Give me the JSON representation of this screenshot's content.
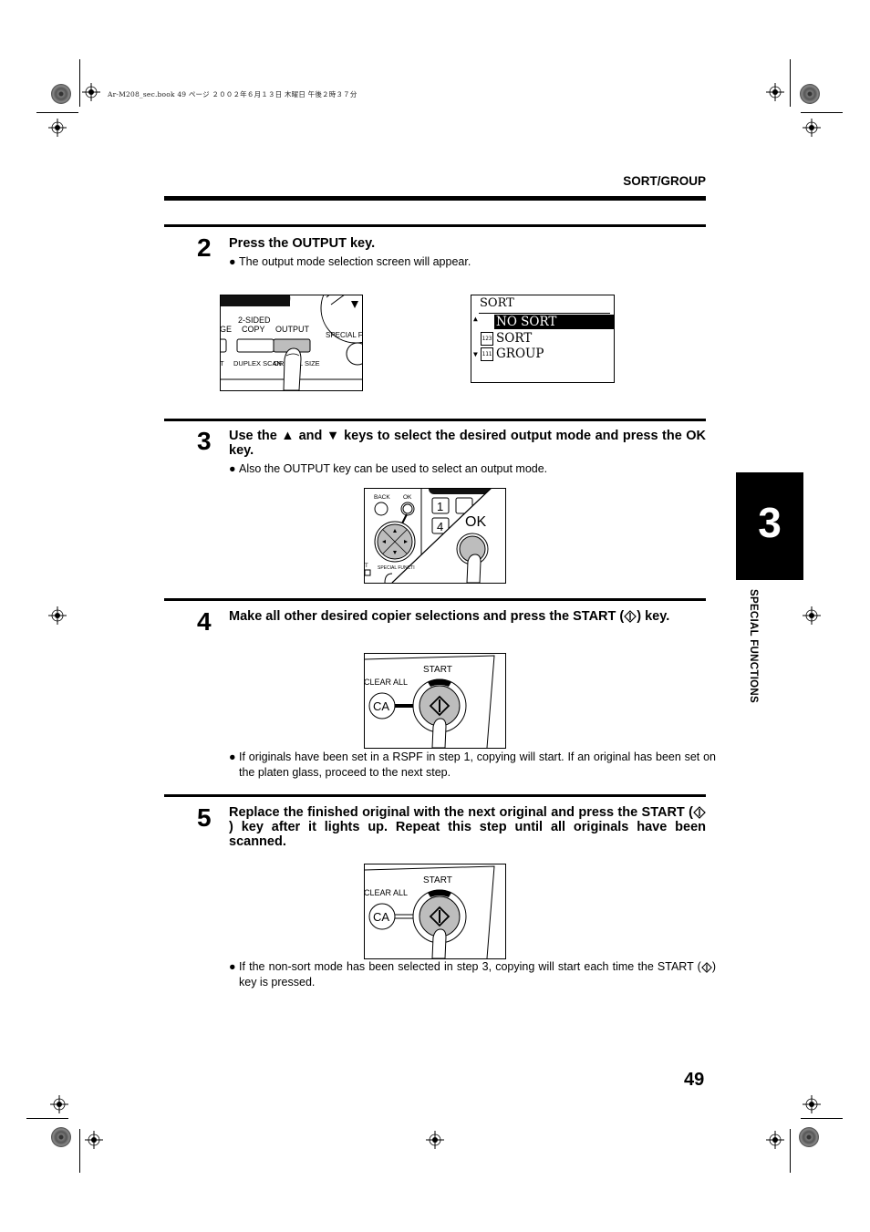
{
  "print_header": {
    "text": "Ar-M208_sec.book  49 ページ  ２００２年６月１３日  木曜日  午後２時３７分"
  },
  "section_title": "SORT/GROUP",
  "chapter_tab": {
    "number": "3",
    "label": "SPECIAL FUNCTIONS"
  },
  "steps": [
    {
      "number": "2",
      "instruction": "Press the OUTPUT key.",
      "bullets": [
        "The output mode selection screen will appear."
      ],
      "figure_panel": {
        "labels": [
          "2-SIDED",
          "COPY",
          "OUTPUT",
          "SPECIAL FU",
          "DUPLEX SCAN",
          "OR",
          "L SIZE",
          "GE",
          "T"
        ]
      },
      "lcd": {
        "title": "SORT",
        "items": [
          {
            "label": "NO SORT",
            "selected": true,
            "icon": ""
          },
          {
            "label": "SORT",
            "selected": false,
            "icon": "123"
          },
          {
            "label": "GROUP",
            "selected": false,
            "icon": "111"
          }
        ],
        "up_arrow": "▲",
        "down_arrow": "▼"
      }
    },
    {
      "number": "3",
      "instruction": "Use the ▲ and ▼ keys to select the desired output mode and press the OK key.",
      "bullets": [
        "Also the OUTPUT key can be used to select an output mode."
      ],
      "figure_panel": {
        "labels": [
          "BACK",
          "OK",
          "1",
          "4",
          "OK",
          "SPECIAL FUNCTI",
          "T"
        ]
      }
    },
    {
      "number": "4",
      "instruction_before": "Make all other desired copier selections and press the START (",
      "instruction_after": ") key.",
      "bullets": [
        "If originals have been set in a RSPF in step 1, copying will start. If an original has been set on the platen glass, proceed to the next step."
      ],
      "figure_panel": {
        "labels": [
          "START",
          "CLEAR ALL",
          "CA"
        ]
      }
    },
    {
      "number": "5",
      "instruction_before": "Replace the finished original with the next original and press the START (",
      "instruction_after": ") key after it lights up. Repeat this step until all originals have been scanned.",
      "bullets_before": "If the non-sort mode has been selected in step 3, copying will start each time the START (",
      "bullets_after": ") key is pressed.",
      "figure_panel": {
        "labels": [
          "START",
          "CLEAR ALL",
          "CA"
        ]
      }
    }
  ],
  "page_number": "49"
}
